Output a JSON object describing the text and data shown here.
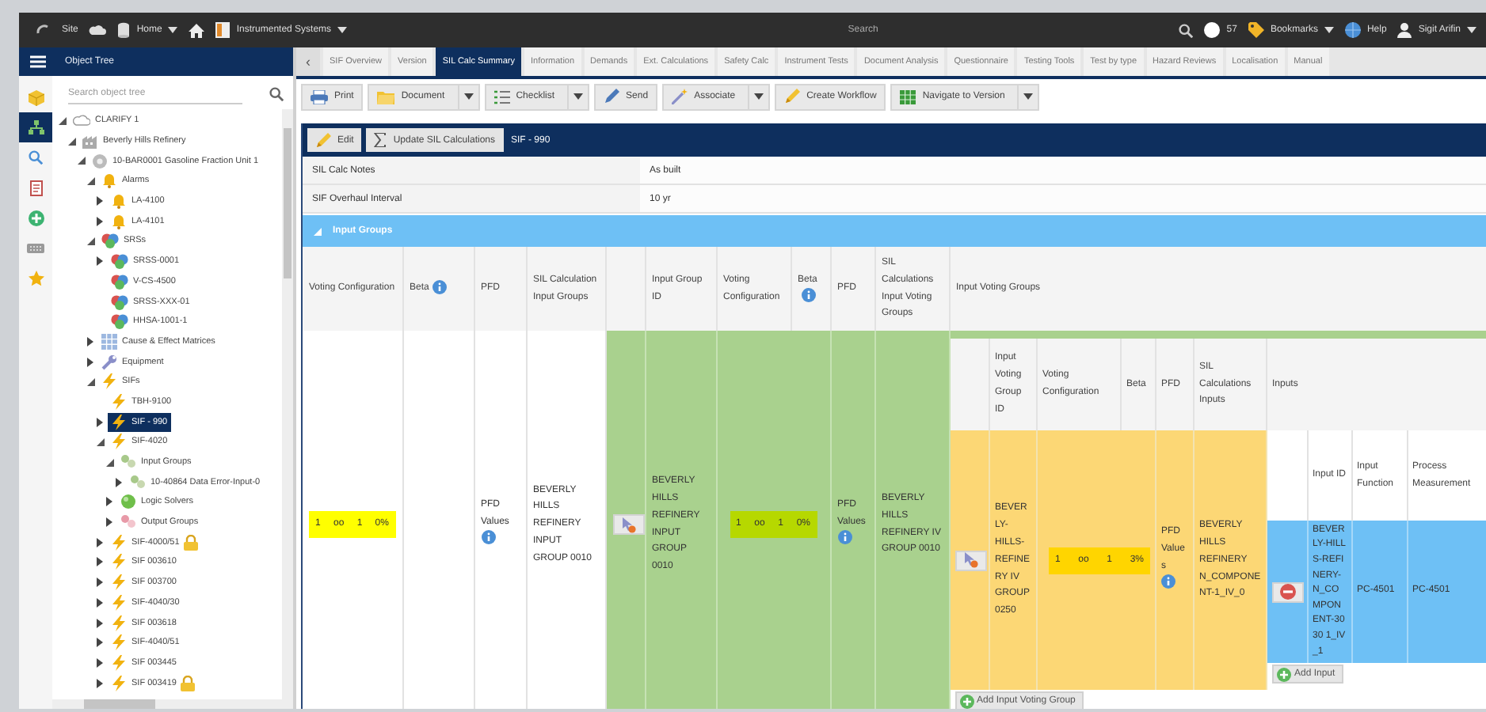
{
  "topbar": {
    "site": "Site",
    "home_menu": "Home",
    "module_menu": "Instrumented Systems",
    "search": {
      "placeholder": "Search"
    },
    "notifications": "57",
    "bookmarks": "Bookmarks",
    "help": "Help",
    "user": "Sigit Arifin"
  },
  "object_tree": {
    "title": "Object Tree",
    "search": {
      "placeholder": "Search object tree"
    },
    "rail": [
      {
        "kind": "cube",
        "selected": false
      },
      {
        "kind": "tree",
        "selected": true
      },
      {
        "kind": "search",
        "selected": false
      },
      {
        "kind": "report",
        "selected": false
      },
      {
        "kind": "addcircle",
        "selected": false
      },
      {
        "kind": "keyboard",
        "selected": false
      },
      {
        "kind": "star",
        "selected": false
      }
    ],
    "items": [
      {
        "label": "CLARIFY 1",
        "kind": "site",
        "expandable": true,
        "expanded": true,
        "selected": false,
        "locked": false,
        "children": [
          {
            "label": "Beverly Hills Refinery",
            "kind": "plant",
            "expandable": true,
            "expanded": true,
            "selected": false,
            "locked": false,
            "children": [
              {
                "label": "10-BAR0001 Gasoline Fraction Unit 1",
                "kind": "unit",
                "expandable": true,
                "expanded": true,
                "selected": false,
                "locked": false,
                "children": [
                  {
                    "label": "Alarms",
                    "kind": "alarm",
                    "expandable": true,
                    "expanded": true,
                    "selected": false,
                    "locked": false,
                    "children": [
                      {
                        "label": "LA-4100",
                        "kind": "alarm",
                        "expandable": true,
                        "expanded": false,
                        "selected": false,
                        "locked": false
                      },
                      {
                        "label": "LA-4101",
                        "kind": "alarm",
                        "expandable": true,
                        "expanded": false,
                        "selected": false,
                        "locked": false
                      }
                    ]
                  },
                  {
                    "label": "SRSs",
                    "kind": "srs",
                    "expandable": true,
                    "expanded": true,
                    "selected": false,
                    "locked": false,
                    "children": [
                      {
                        "label": "SRSS-0001",
                        "kind": "srs",
                        "expandable": true,
                        "expanded": false,
                        "selected": false,
                        "locked": false
                      },
                      {
                        "label": "V-CS-4500",
                        "kind": "srs",
                        "expandable": false,
                        "selected": false,
                        "locked": false
                      },
                      {
                        "label": "SRSS-XXX-01",
                        "kind": "srs",
                        "expandable": false,
                        "selected": false,
                        "locked": false
                      },
                      {
                        "label": "HHSA-1001-1",
                        "kind": "srs",
                        "expandable": false,
                        "selected": false,
                        "locked": false
                      }
                    ]
                  },
                  {
                    "label": "Cause & Effect Matrices",
                    "kind": "matrix",
                    "expandable": true,
                    "expanded": false,
                    "selected": false,
                    "locked": false
                  },
                  {
                    "label": "Equipment",
                    "kind": "equipment",
                    "expandable": true,
                    "expanded": false,
                    "selected": false,
                    "locked": false
                  },
                  {
                    "label": "SIFs",
                    "kind": "sif",
                    "expandable": true,
                    "expanded": true,
                    "selected": false,
                    "locked": false,
                    "children": [
                      {
                        "label": "TBH-9100",
                        "kind": "sif",
                        "expandable": false,
                        "selected": false,
                        "locked": false
                      },
                      {
                        "label": "SIF - 990",
                        "kind": "sif",
                        "expandable": true,
                        "expanded": false,
                        "selected": true,
                        "locked": false
                      },
                      {
                        "label": "SIF-4020",
                        "kind": "sif",
                        "expandable": true,
                        "expanded": true,
                        "selected": false,
                        "locked": false,
                        "children": [
                          {
                            "label": "Input Groups",
                            "kind": "group",
                            "expandable": true,
                            "expanded": true,
                            "selected": false,
                            "locked": false,
                            "children": [
                              {
                                "label": "10-40864 Data Error-Input-0",
                                "kind": "group",
                                "expandable": true,
                                "expanded": false,
                                "selected": false,
                                "locked": false
                              }
                            ]
                          },
                          {
                            "label": "Logic Solvers",
                            "kind": "logic",
                            "expandable": true,
                            "expanded": false,
                            "selected": false,
                            "locked": false
                          },
                          {
                            "label": "Output Groups",
                            "kind": "output",
                            "expandable": true,
                            "expanded": false,
                            "selected": false,
                            "locked": false
                          }
                        ]
                      },
                      {
                        "label": "SIF-4000/51",
                        "kind": "sif",
                        "expandable": true,
                        "expanded": false,
                        "selected": false,
                        "locked": true
                      },
                      {
                        "label": "SIF 003610",
                        "kind": "sif",
                        "expandable": true,
                        "expanded": false,
                        "selected": false,
                        "locked": false
                      },
                      {
                        "label": "SIF 003700",
                        "kind": "sif",
                        "expandable": true,
                        "expanded": false,
                        "selected": false,
                        "locked": false
                      },
                      {
                        "label": "SIF-4040/30",
                        "kind": "sif",
                        "expandable": true,
                        "expanded": false,
                        "selected": false,
                        "locked": false
                      },
                      {
                        "label": "SIF 003618",
                        "kind": "sif",
                        "expandable": true,
                        "expanded": false,
                        "selected": false,
                        "locked": false
                      },
                      {
                        "label": "SIF-4040/51",
                        "kind": "sif",
                        "expandable": true,
                        "expanded": false,
                        "selected": false,
                        "locked": false
                      },
                      {
                        "label": "SIF 003445",
                        "kind": "sif",
                        "expandable": true,
                        "expanded": false,
                        "selected": false,
                        "locked": false
                      },
                      {
                        "label": "SIF 003419",
                        "kind": "sif",
                        "expandable": true,
                        "expanded": false,
                        "selected": false,
                        "locked": true
                      }
                    ]
                  }
                ]
              }
            ]
          }
        ]
      }
    ]
  },
  "collapse_button": "‹",
  "tabs": [
    {
      "label": "SIF Overview",
      "selected": false
    },
    {
      "label": "Version",
      "selected": false
    },
    {
      "label": "SIL Calc Summary",
      "selected": true
    },
    {
      "label": "Information",
      "selected": false
    },
    {
      "label": "Demands",
      "selected": false
    },
    {
      "label": "Ext. Calculations",
      "selected": false
    },
    {
      "label": "Safety Calc",
      "selected": false
    },
    {
      "label": "Instrument Tests",
      "selected": false
    },
    {
      "label": "Document Analysis",
      "selected": false
    },
    {
      "label": "Questionnaire",
      "selected": false
    },
    {
      "label": "Testing Tools",
      "selected": false
    },
    {
      "label": "Test by type",
      "selected": false
    },
    {
      "label": "Hazard Reviews",
      "selected": false
    },
    {
      "label": "Localisation",
      "selected": false
    },
    {
      "label": "Manual",
      "selected": false
    }
  ],
  "toolbar": [
    {
      "label": "Print",
      "kind": "print",
      "dropdown": false
    },
    {
      "label": "Document",
      "kind": "document",
      "dropdown": true
    },
    {
      "label": "Checklist",
      "kind": "checklist",
      "dropdown": true
    },
    {
      "label": "Send",
      "kind": "send",
      "dropdown": false
    },
    {
      "label": "Associate",
      "kind": "associate",
      "dropdown": true
    },
    {
      "label": "Create Workflow",
      "kind": "workflow",
      "dropdown": false
    },
    {
      "label": "Navigate to Version",
      "kind": "sheet",
      "dropdown": true
    }
  ],
  "sif": {
    "actions": [
      {
        "label": "Edit",
        "kind": "edit"
      },
      {
        "label": "Update SIL Calculations",
        "kind": "sigma"
      }
    ],
    "title": "SIF - 990",
    "fields": [
      {
        "label": "SIL Calc Notes",
        "value": "As built"
      },
      {
        "label": "SIF Overhaul Interval",
        "value": "10 yr"
      }
    ],
    "input_groups": {
      "title": "Input Groups",
      "expanded": true,
      "columns": [
        {
          "label": "Voting Configuration",
          "info": false
        },
        {
          "label": "Beta",
          "info": true
        },
        {
          "label": "PFD",
          "info": false
        },
        {
          "label": "SIL Calculation Input Groups",
          "info": false
        }
      ],
      "row": {
        "voting": [
          "1",
          "oo",
          "1",
          "0%"
        ],
        "pfd": "PFD Values",
        "sil_calc": "BEVERLY HILLS REFINERY INPUT GROUP 0010"
      },
      "group_columns": [
        {
          "label": "Input Group ID",
          "info": false
        },
        {
          "label": "Voting Configuration",
          "info": false
        },
        {
          "label": "Beta",
          "info": true
        },
        {
          "label": "PFD",
          "info": false
        },
        {
          "label": "SIL Calculations Input Voting Groups",
          "info": false
        },
        {
          "label": "Input Voting Groups",
          "info": false
        }
      ],
      "groups": [
        {
          "id": "BEVERLY HILLS REFINERY INPUT GROUP 0010",
          "voting": [
            "1",
            "oo",
            "1",
            "0%"
          ],
          "pfd": "PFD Values",
          "sil_calc": "BEVERLY HILLS REFINERY IV GROUP 0010",
          "voting_groups": {
            "columns": [
              {
                "label": "Input Voting Group ID"
              },
              {
                "label": "Voting Configuration"
              },
              {
                "label": "Beta"
              },
              {
                "label": "PFD"
              },
              {
                "label": "SIL Calculations Inputs"
              },
              {
                "label": "Inputs"
              }
            ],
            "rows": [
              {
                "id": "BEVERLY-HILLS-REFINERY IV GROUP 0250",
                "voting": [
                  "1",
                  "oo",
                  "1",
                  "3%"
                ],
                "pfd": "PFD Values",
                "sil_calc": "BEVERLY HILLS REFINERY N_COMPONENT-1_IV_0",
                "inputs": {
                  "columns": [
                    "Input ID",
                    "Input Function",
                    "Process Measurement"
                  ],
                  "rows": [
                    {
                      "id": "BEVERLY-HILLS-REFINERY-N_COMPONENT-3030 1_IV_1",
                      "function": "PC-4501",
                      "measurement": "PC-4501"
                    }
                  ],
                  "add": "Add Input"
                }
              }
            ],
            "add": "Add Input Voting Group"
          }
        }
      ]
    }
  }
}
